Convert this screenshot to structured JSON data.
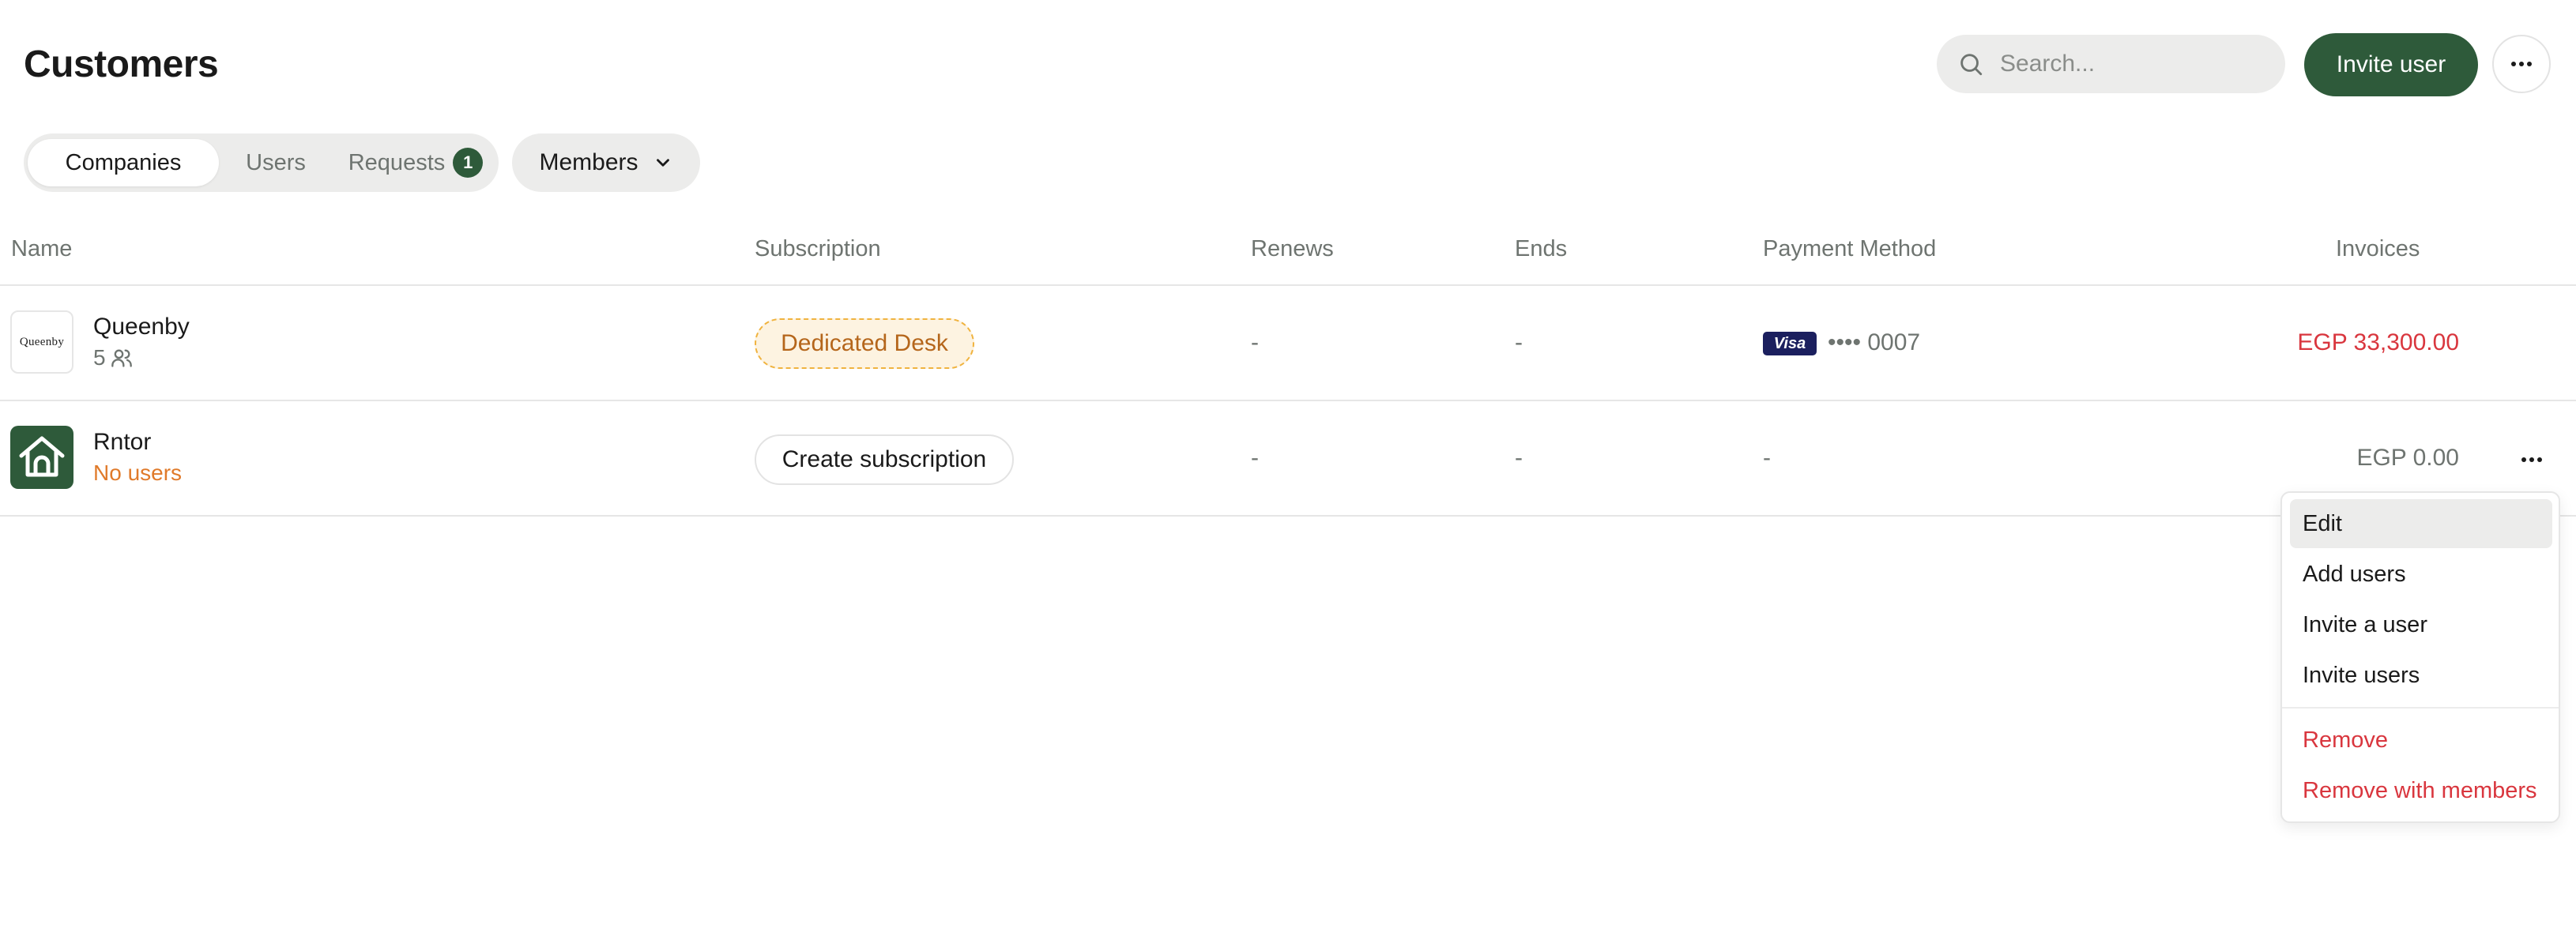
{
  "page": {
    "title": "Customers"
  },
  "header": {
    "search_placeholder": "Search...",
    "invite_label": "Invite user"
  },
  "tabs": [
    {
      "label": "Companies",
      "active": true
    },
    {
      "label": "Users",
      "active": false
    },
    {
      "label": "Requests",
      "active": false,
      "badge": "1"
    }
  ],
  "filter": {
    "members_label": "Members"
  },
  "table": {
    "columns": [
      "Name",
      "Subscription",
      "Renews",
      "Ends",
      "Payment Method",
      "Invoices"
    ],
    "rows": [
      {
        "logo_text": "Queenby",
        "name": "Queenby",
        "sub": "5",
        "subscription": "Dedicated Desk",
        "renews": "-",
        "ends": "-",
        "payment_brand": "Visa",
        "payment_number": "•••• 0007",
        "invoices": "EGP 33,300.00"
      },
      {
        "name": "Rntor",
        "sub": "No users",
        "subscription": "Create subscription",
        "renews": "-",
        "ends": "-",
        "payment": "-",
        "invoices": "EGP 0.00"
      }
    ]
  },
  "menu": {
    "items": [
      "Edit",
      "Add users",
      "Invite a user",
      "Invite users"
    ],
    "danger_items": [
      "Remove",
      "Remove with members"
    ]
  },
  "colors": {
    "brand": "#2e5a3a",
    "danger": "#d9363e",
    "warning": "#e07a2a",
    "chip_bg": "#fdf3e1",
    "chip_border": "#f0b33f"
  }
}
